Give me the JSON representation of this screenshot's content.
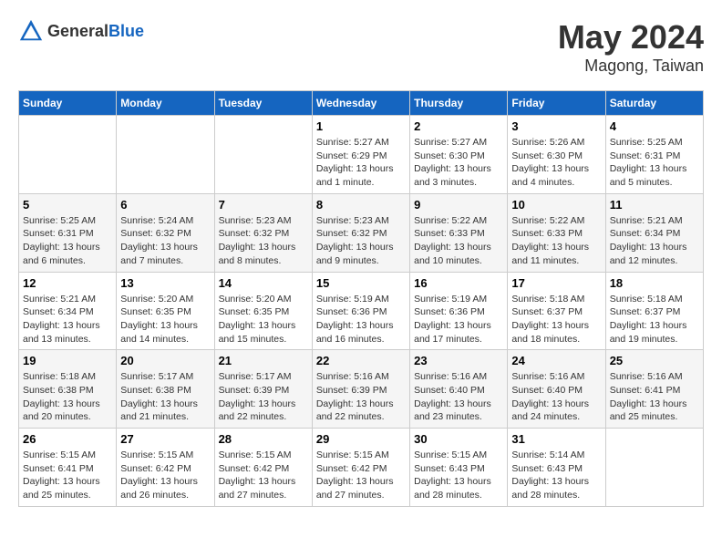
{
  "header": {
    "logo_general": "General",
    "logo_blue": "Blue",
    "title": "May 2024",
    "location": "Magong, Taiwan"
  },
  "days_of_week": [
    "Sunday",
    "Monday",
    "Tuesday",
    "Wednesday",
    "Thursday",
    "Friday",
    "Saturday"
  ],
  "weeks": [
    [
      {
        "day": "",
        "info": ""
      },
      {
        "day": "",
        "info": ""
      },
      {
        "day": "",
        "info": ""
      },
      {
        "day": "1",
        "info": "Sunrise: 5:27 AM\nSunset: 6:29 PM\nDaylight: 13 hours\nand 1 minute."
      },
      {
        "day": "2",
        "info": "Sunrise: 5:27 AM\nSunset: 6:30 PM\nDaylight: 13 hours\nand 3 minutes."
      },
      {
        "day": "3",
        "info": "Sunrise: 5:26 AM\nSunset: 6:30 PM\nDaylight: 13 hours\nand 4 minutes."
      },
      {
        "day": "4",
        "info": "Sunrise: 5:25 AM\nSunset: 6:31 PM\nDaylight: 13 hours\nand 5 minutes."
      }
    ],
    [
      {
        "day": "5",
        "info": "Sunrise: 5:25 AM\nSunset: 6:31 PM\nDaylight: 13 hours\nand 6 minutes."
      },
      {
        "day": "6",
        "info": "Sunrise: 5:24 AM\nSunset: 6:32 PM\nDaylight: 13 hours\nand 7 minutes."
      },
      {
        "day": "7",
        "info": "Sunrise: 5:23 AM\nSunset: 6:32 PM\nDaylight: 13 hours\nand 8 minutes."
      },
      {
        "day": "8",
        "info": "Sunrise: 5:23 AM\nSunset: 6:32 PM\nDaylight: 13 hours\nand 9 minutes."
      },
      {
        "day": "9",
        "info": "Sunrise: 5:22 AM\nSunset: 6:33 PM\nDaylight: 13 hours\nand 10 minutes."
      },
      {
        "day": "10",
        "info": "Sunrise: 5:22 AM\nSunset: 6:33 PM\nDaylight: 13 hours\nand 11 minutes."
      },
      {
        "day": "11",
        "info": "Sunrise: 5:21 AM\nSunset: 6:34 PM\nDaylight: 13 hours\nand 12 minutes."
      }
    ],
    [
      {
        "day": "12",
        "info": "Sunrise: 5:21 AM\nSunset: 6:34 PM\nDaylight: 13 hours\nand 13 minutes."
      },
      {
        "day": "13",
        "info": "Sunrise: 5:20 AM\nSunset: 6:35 PM\nDaylight: 13 hours\nand 14 minutes."
      },
      {
        "day": "14",
        "info": "Sunrise: 5:20 AM\nSunset: 6:35 PM\nDaylight: 13 hours\nand 15 minutes."
      },
      {
        "day": "15",
        "info": "Sunrise: 5:19 AM\nSunset: 6:36 PM\nDaylight: 13 hours\nand 16 minutes."
      },
      {
        "day": "16",
        "info": "Sunrise: 5:19 AM\nSunset: 6:36 PM\nDaylight: 13 hours\nand 17 minutes."
      },
      {
        "day": "17",
        "info": "Sunrise: 5:18 AM\nSunset: 6:37 PM\nDaylight: 13 hours\nand 18 minutes."
      },
      {
        "day": "18",
        "info": "Sunrise: 5:18 AM\nSunset: 6:37 PM\nDaylight: 13 hours\nand 19 minutes."
      }
    ],
    [
      {
        "day": "19",
        "info": "Sunrise: 5:18 AM\nSunset: 6:38 PM\nDaylight: 13 hours\nand 20 minutes."
      },
      {
        "day": "20",
        "info": "Sunrise: 5:17 AM\nSunset: 6:38 PM\nDaylight: 13 hours\nand 21 minutes."
      },
      {
        "day": "21",
        "info": "Sunrise: 5:17 AM\nSunset: 6:39 PM\nDaylight: 13 hours\nand 22 minutes."
      },
      {
        "day": "22",
        "info": "Sunrise: 5:16 AM\nSunset: 6:39 PM\nDaylight: 13 hours\nand 22 minutes."
      },
      {
        "day": "23",
        "info": "Sunrise: 5:16 AM\nSunset: 6:40 PM\nDaylight: 13 hours\nand 23 minutes."
      },
      {
        "day": "24",
        "info": "Sunrise: 5:16 AM\nSunset: 6:40 PM\nDaylight: 13 hours\nand 24 minutes."
      },
      {
        "day": "25",
        "info": "Sunrise: 5:16 AM\nSunset: 6:41 PM\nDaylight: 13 hours\nand 25 minutes."
      }
    ],
    [
      {
        "day": "26",
        "info": "Sunrise: 5:15 AM\nSunset: 6:41 PM\nDaylight: 13 hours\nand 25 minutes."
      },
      {
        "day": "27",
        "info": "Sunrise: 5:15 AM\nSunset: 6:42 PM\nDaylight: 13 hours\nand 26 minutes."
      },
      {
        "day": "28",
        "info": "Sunrise: 5:15 AM\nSunset: 6:42 PM\nDaylight: 13 hours\nand 27 minutes."
      },
      {
        "day": "29",
        "info": "Sunrise: 5:15 AM\nSunset: 6:42 PM\nDaylight: 13 hours\nand 27 minutes."
      },
      {
        "day": "30",
        "info": "Sunrise: 5:15 AM\nSunset: 6:43 PM\nDaylight: 13 hours\nand 28 minutes."
      },
      {
        "day": "31",
        "info": "Sunrise: 5:14 AM\nSunset: 6:43 PM\nDaylight: 13 hours\nand 28 minutes."
      },
      {
        "day": "",
        "info": ""
      }
    ]
  ]
}
